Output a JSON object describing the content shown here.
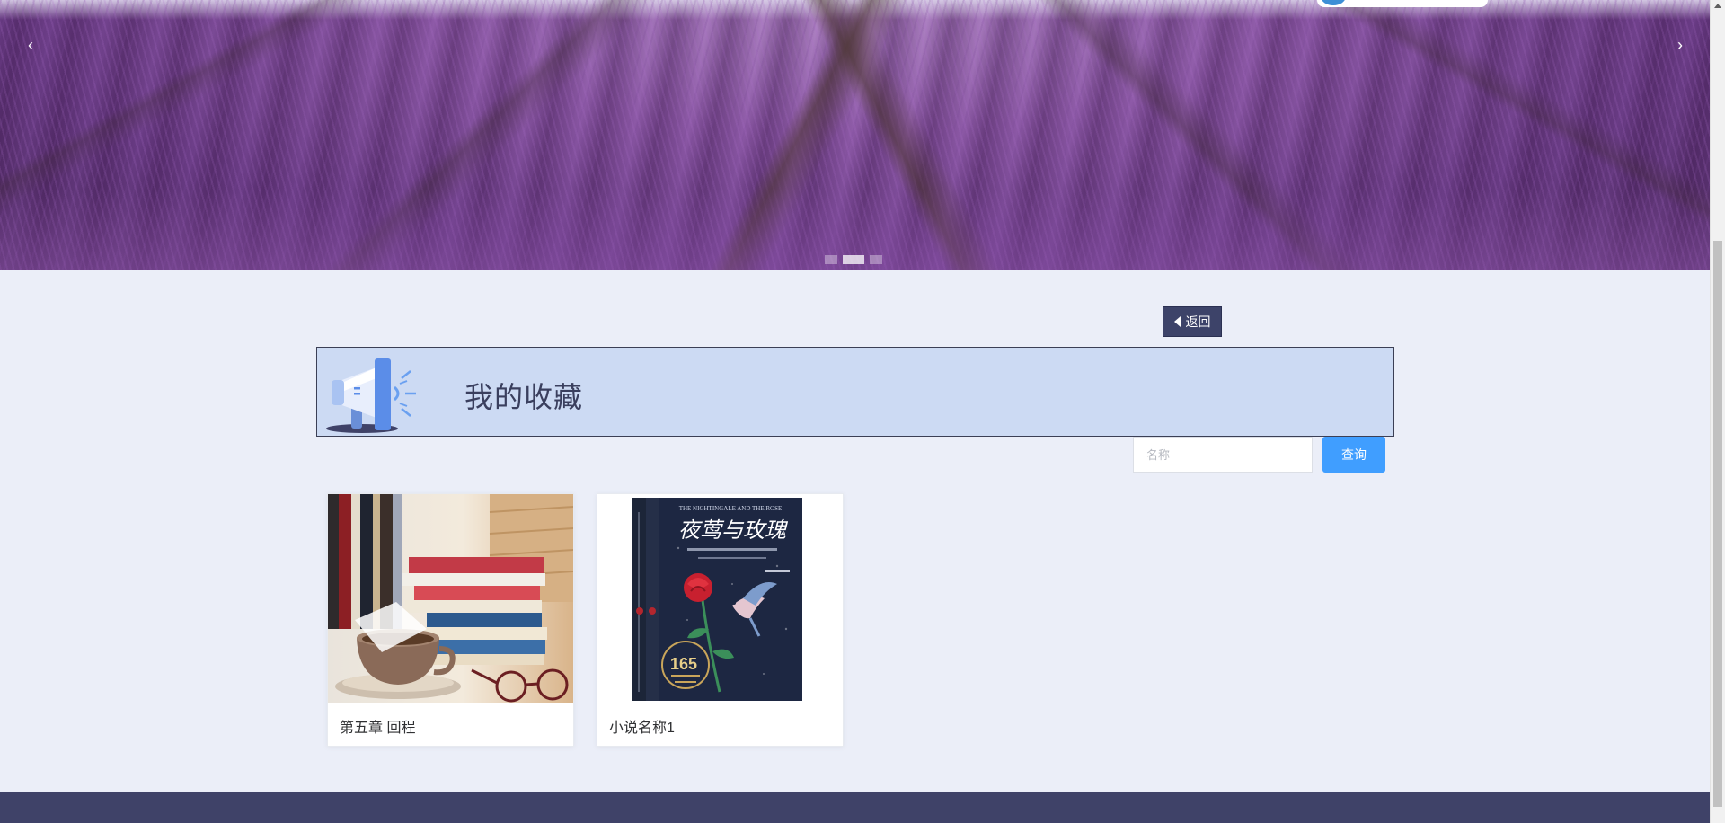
{
  "banner": {
    "prev_icon": "chevron-left-icon",
    "next_icon": "chevron-right-icon",
    "prev_glyph": "‹",
    "next_glyph": "›",
    "slide_count": 3,
    "active_slide": 2
  },
  "back_button": {
    "label": "返回",
    "icon": "caret-left-icon"
  },
  "header": {
    "title": "我的收藏",
    "icon": "megaphone-icon"
  },
  "search": {
    "placeholder": "名称",
    "value": "",
    "button_label": "查询"
  },
  "favorites": [
    {
      "title": "第五章 回程",
      "cover": "books-coffee-cover"
    },
    {
      "title": "小说名称1",
      "cover": "nightingale-rose-cover"
    }
  ],
  "book_cover_text": {
    "english_title": "THE NIGHTINGALE AND THE ROSE",
    "chinese_title": "夜莺与玫瑰",
    "number": "165"
  },
  "colors": {
    "accent": "#409eff",
    "dark": "#3d4369",
    "header_bg": "#ccdaf3",
    "page_bg": "#ebeef8"
  }
}
